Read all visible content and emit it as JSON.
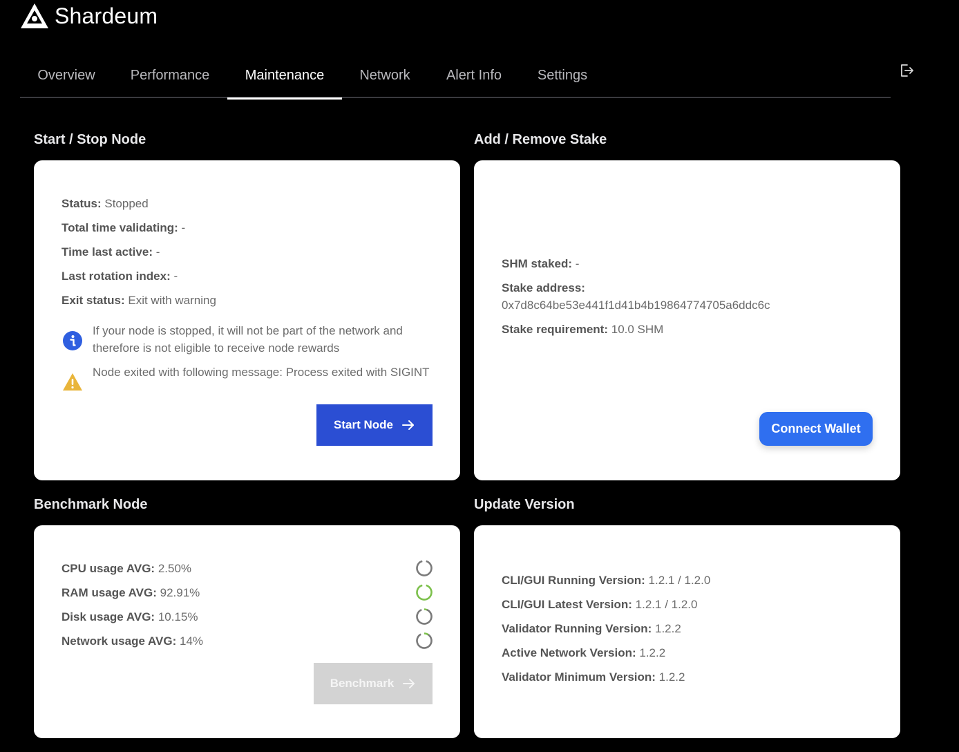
{
  "brand": {
    "name": "Shardeum",
    "logo_icon": "shardeum-logo-icon"
  },
  "tabs": [
    {
      "label": "Overview",
      "active": false
    },
    {
      "label": "Performance",
      "active": false
    },
    {
      "label": "Maintenance",
      "active": true
    },
    {
      "label": "Network",
      "active": false
    },
    {
      "label": "Alert Info",
      "active": false
    },
    {
      "label": "Settings",
      "active": false
    }
  ],
  "header": {
    "logout_icon": "logout-icon"
  },
  "start_stop": {
    "title": "Start / Stop Node",
    "fields": [
      {
        "label": "Status:",
        "value": "Stopped"
      },
      {
        "label": "Total time validating:",
        "value": "-"
      },
      {
        "label": "Time last active:",
        "value": "-"
      },
      {
        "label": "Last rotation index:",
        "value": "-"
      },
      {
        "label": "Exit status:",
        "value": "Exit with warning"
      }
    ],
    "info_note": "If your node is stopped, it will not be part of the network and therefore is not eligible to receive node rewards",
    "warning_note": "Node exited with following message: Process exited with SIGINT",
    "button_label": "Start Node"
  },
  "stake": {
    "title": "Add / Remove Stake",
    "shm_staked_label": "SHM staked:",
    "shm_staked_value": "-",
    "stake_address_label": "Stake address:",
    "stake_address_value": "0x7d8c64be53e441f1d41b4b19864774705a6ddc6c",
    "stake_requirement_label": "Stake requirement:",
    "stake_requirement_value": "10.0 SHM",
    "button_label": "Connect Wallet"
  },
  "benchmark": {
    "title": "Benchmark Node",
    "metrics": [
      {
        "label": "CPU usage AVG:",
        "value": "2.50%"
      },
      {
        "label": "RAM usage AVG:",
        "value": "92.91%"
      },
      {
        "label": "Disk usage AVG:",
        "value": "10.15%"
      },
      {
        "label": "Network usage AVG:",
        "value": "14%"
      }
    ],
    "button_label": "Benchmark"
  },
  "update": {
    "title": "Update Version",
    "fields": [
      {
        "label": "CLI/GUI Running Version:",
        "value": "1.2.1 / 1.2.0"
      },
      {
        "label": "CLI/GUI Latest Version:",
        "value": "1.2.1 / 1.2.0"
      },
      {
        "label": "Validator Running Version:",
        "value": "1.2.2"
      },
      {
        "label": "Active Network Version:",
        "value": "1.2.2"
      },
      {
        "label": "Validator Minimum Version:",
        "value": "1.2.2"
      }
    ]
  },
  "colors": {
    "primary_button": "#2b4ed3",
    "wallet_button": "#2f6ff0",
    "info_icon": "#2f5fe0",
    "warning_icon": "#e9b53a",
    "spinner_gray": "#7a7a7a",
    "spinner_green": "#7cc04b"
  }
}
